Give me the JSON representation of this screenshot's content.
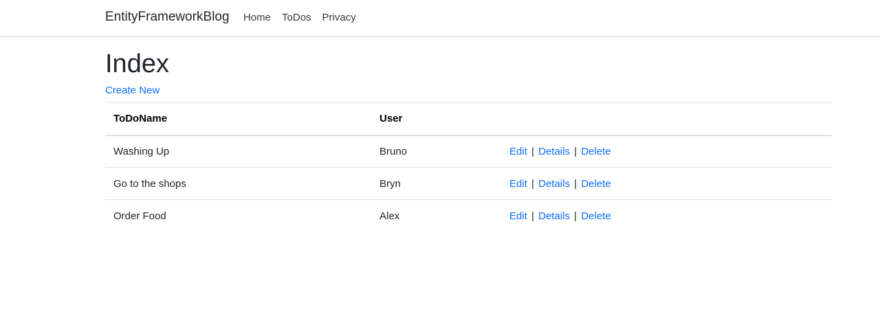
{
  "navbar": {
    "brand": "EntityFrameworkBlog",
    "links": [
      "Home",
      "ToDos",
      "Privacy"
    ]
  },
  "main": {
    "title": "Index",
    "create_label": "Create New"
  },
  "table": {
    "headers": [
      "ToDoName",
      "User"
    ],
    "rows": [
      {
        "name": "Washing Up",
        "user": "Bruno"
      },
      {
        "name": "Go to the shops",
        "user": "Bryn"
      },
      {
        "name": "Order Food",
        "user": "Alex"
      }
    ],
    "actions": {
      "edit": "Edit",
      "details": "Details",
      "delete": "Delete",
      "separator": "|"
    }
  },
  "colors": {
    "link": "#0d6efd",
    "text": "#212529",
    "border": "#dee2e6"
  }
}
